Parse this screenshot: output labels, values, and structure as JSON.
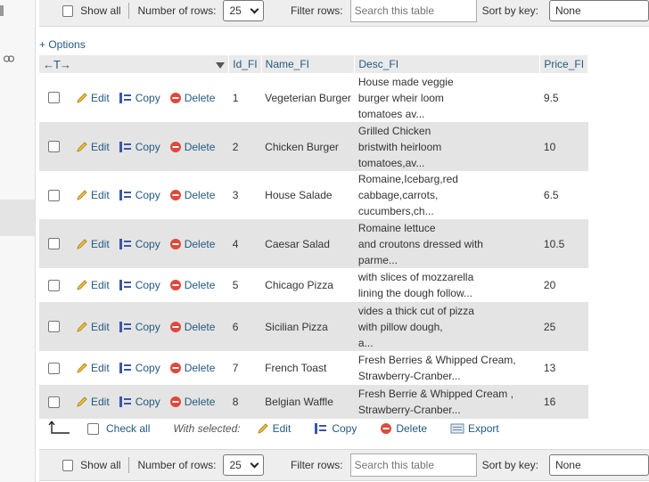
{
  "navigation": {
    "show_all": "Show all",
    "number_of_rows_label": "Number of rows:",
    "number_of_rows_value": "25",
    "filter_rows_label": "Filter rows:",
    "filter_placeholder": "Search this table",
    "sort_by_key_label": "Sort by key:",
    "sort_by_key_value": "None"
  },
  "options_link": "+ Options",
  "table": {
    "arrows": "←T→",
    "columns": [
      "Id_FI",
      "Name_FI",
      "Desc_FI",
      "Price_FI"
    ],
    "actions": {
      "edit": "Edit",
      "copy": "Copy",
      "delete": "Delete"
    },
    "rows": [
      {
        "id": "1",
        "name": "Vegeterian Burger",
        "desc": [
          "House made veggie",
          "burger wheir loom",
          "tomatoes av..."
        ],
        "price": "9.5"
      },
      {
        "id": "2",
        "name": "Chicken Burger",
        "desc": [
          "Grilled Chicken",
          "bristwith heirloom",
          "tomatoes,av..."
        ],
        "price": "10"
      },
      {
        "id": "3",
        "name": "House Salade",
        "desc": [
          "Romaine,Icebarg,red cabbage,carrots,",
          "cucumbers,ch..."
        ],
        "price": "6.5"
      },
      {
        "id": "4",
        "name": "Caesar Salad",
        "desc": [
          "Romaine lettuce",
          "and croutons dressed with",
          "parme..."
        ],
        "price": "10.5"
      },
      {
        "id": "5",
        "name": "Chicago Pizza",
        "desc": [
          "with slices of mozzarella",
          "lining the dough follow..."
        ],
        "price": "20"
      },
      {
        "id": "6",
        "name": "Sicilian Pizza",
        "desc": [
          "vides a thick cut of pizza",
          "with pillow dough,",
          "a..."
        ],
        "price": "25"
      },
      {
        "id": "7",
        "name": "French Toast",
        "desc": [
          "Fresh Berries & Whipped Cream,",
          "Strawberry-Cranber..."
        ],
        "price": "13"
      },
      {
        "id": "8",
        "name": "Belgian Waffle",
        "desc": [
          "Fresh Berrie & Whipped Cream ,",
          "Strawberry-Cranber..."
        ],
        "price": "16"
      }
    ]
  },
  "multi_actions": {
    "check_all": "Check all",
    "with_selected": "With selected:",
    "edit": "Edit",
    "copy": "Copy",
    "delete": "Delete",
    "export": "Export"
  }
}
